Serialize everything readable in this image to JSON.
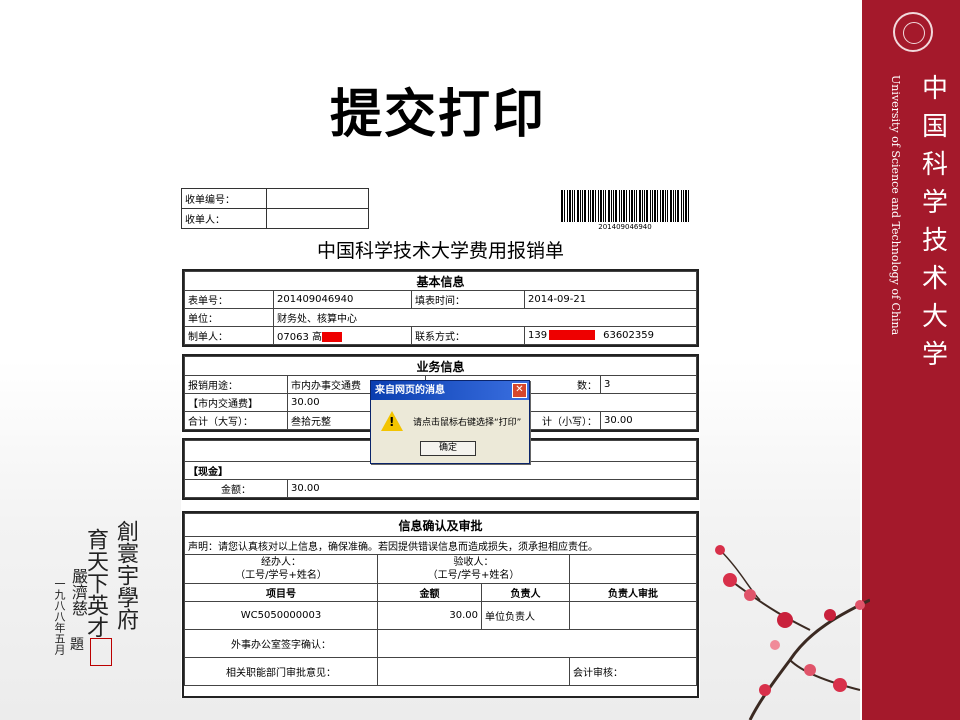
{
  "slide": {
    "title": "提交打印"
  },
  "brand": {
    "name_cn": [
      "中",
      "国",
      "科",
      "学",
      "技",
      "术",
      "大",
      "学"
    ],
    "name_en": "University of Science and Technology of China",
    "band_color": "#a4192b"
  },
  "calligraphy": {
    "columns": [
      "創寰宇學府",
      "育天下英才"
    ],
    "author": "嚴濟慈",
    "date": "一九八八年五月",
    "sign": "題"
  },
  "receipt_box": {
    "labels": [
      "收单编号：",
      "收单人："
    ]
  },
  "barcode_number": "201409046940",
  "document_title": "中国科学技术大学费用报销单",
  "basic_info": {
    "heading": "基本信息",
    "rows": [
      [
        "表单号：",
        "201409046940",
        "填表时间：",
        "2014-09-21"
      ],
      [
        "单位：",
        "财务处、核算中心"
      ],
      [
        "制单人：",
        "07063  高",
        "联系方式：",
        "139",
        "63602359"
      ]
    ]
  },
  "business_info": {
    "heading": "业务信息",
    "rows": [
      [
        "报销用途：",
        "市内办事交通费",
        "数：",
        "3"
      ],
      [
        "【市内交通费】",
        "30.00"
      ],
      [
        "合计（大写）：",
        "叁拾元整",
        "计（小写）：",
        "30.00"
      ]
    ]
  },
  "payment": {
    "method": "【现金】",
    "amount_label": "金额：",
    "amount": "30.00"
  },
  "confirm": {
    "heading": "信息确认及审批",
    "statement": "声明：请您认真核对以上信息，确保准确。若因提供错误信息而造成损失，须承担相应责任。",
    "handler_label": "经办人：",
    "handler_hint": "（工号/学号+姓名）",
    "receiver_label": "验收人：",
    "receiver_hint": "（工号/学号+姓名）",
    "columns": [
      "项目号",
      "金额",
      "负责人",
      "负责人审批"
    ],
    "item": {
      "project": "WC5050000003",
      "amount": "30.00",
      "owner": "单位负责人"
    },
    "foreign_affairs": "外事办公室签字确认：",
    "dept_approval": "相关职能部门审批意见：",
    "accounting": "会计审核："
  },
  "dialog": {
    "title": "来自网页的消息",
    "message": "请点击鼠标右键选择“打印”",
    "ok_label": "确定",
    "close_glyph": "✕",
    "icon": "warning-icon",
    "icon_glyph": "!"
  }
}
